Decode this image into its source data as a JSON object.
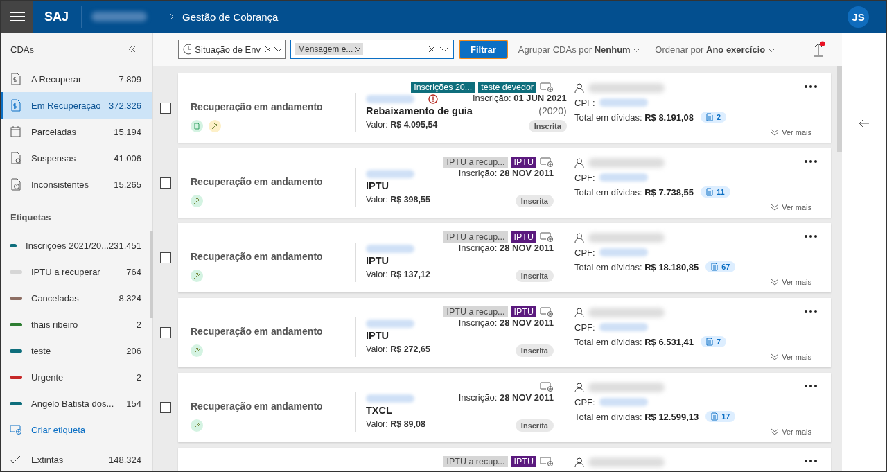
{
  "header": {
    "logo": "SAJ",
    "breadcrumb": "Gestão de Cobrança",
    "avatar": "JS"
  },
  "toolbar": {
    "filters": [
      {
        "kind": "clock",
        "value": "Situação de Env"
      },
      {
        "kind": "chips",
        "chips": [
          "Mensagem e..."
        ],
        "focused": true
      }
    ],
    "filter_button": "Filtrar",
    "group_label": "Agrupar CDAs por",
    "group_value": "Nenhum",
    "sort_label": "Ordenar por",
    "sort_value": "Ano exercício",
    "upload_notification": true
  },
  "sidebar": {
    "title": "CDAs",
    "categories": [
      {
        "label": "A Recuperar",
        "count": "7.809",
        "selected": false
      },
      {
        "label": "Em Recuperação",
        "count": "372.326",
        "selected": true
      },
      {
        "label": "Parceladas",
        "count": "15.194",
        "selected": false
      },
      {
        "label": "Suspensas",
        "count": "41.006",
        "selected": false
      },
      {
        "label": "Inconsistentes",
        "count": "15.265",
        "selected": false
      }
    ],
    "tags_title": "Etiquetas",
    "tags": [
      {
        "label": "Inscrições 2021/20...",
        "count": "231.451",
        "color": "#0e6e7c"
      },
      {
        "label": "IPTU a recuperar",
        "count": "764",
        "color": "#d6d6d6"
      },
      {
        "label": "Canceladas",
        "count": "8.324",
        "color": "#8d6e63"
      },
      {
        "label": "thais ribeiro",
        "count": "2",
        "color": "#2e7d32"
      },
      {
        "label": "teste",
        "count": "206",
        "color": "#0e6e7c"
      },
      {
        "label": "Urgente",
        "count": "2",
        "color": "#c62828"
      },
      {
        "label": "Angelo Batista dos...",
        "count": "154",
        "color": "#0e6e7c"
      }
    ],
    "create_tag": "Criar etiqueta",
    "extinct": {
      "label": "Extintas",
      "count": "148.324"
    }
  },
  "cards": [
    {
      "checked": false,
      "status": "Recuperação em andamento",
      "status_icons": [
        {
          "kind": "document",
          "color": "#d4f3e2"
        },
        {
          "kind": "gavel",
          "color": "#fdf0c8"
        }
      ],
      "tags": [
        {
          "label": "Inscrições 20...",
          "color": "#0e6e7c"
        },
        {
          "label": "teste devedor",
          "color": "#0e6e7c"
        }
      ],
      "warning": true,
      "inscricao_label": "Inscrição:",
      "inscricao": "01 JUN 2021",
      "subject": "Rebaixamento de guia",
      "year": "(2020)",
      "valor_label": "Valor:",
      "valor": "R$ 4.095,54",
      "badge": "Inscrita",
      "cpf_label": "CPF:",
      "total_label": "Total em dívidas:",
      "total": "R$ 8.191,08",
      "docs": "2",
      "more": "Ver mais"
    },
    {
      "checked": false,
      "status": "Recuperação em andamento",
      "status_icons": [
        {
          "kind": "gavel",
          "color": "#d4f3e2"
        }
      ],
      "tags": [
        {
          "label": "IPTU a recup...",
          "color": "#d6d6d6"
        },
        {
          "label": "IPTU",
          "color": "#5b1a7e"
        }
      ],
      "warning": false,
      "inscricao_label": "Inscrição:",
      "inscricao": "28 NOV 2011",
      "subject": "IPTU",
      "valor_label": "Valor:",
      "valor": "R$ 398,55",
      "badge": "Inscrita",
      "cpf_label": "CPF:",
      "total_label": "Total em dívidas:",
      "total": "R$ 7.738,55",
      "docs": "11",
      "more": "Ver mais"
    },
    {
      "checked": false,
      "status": "Recuperação em andamento",
      "status_icons": [
        {
          "kind": "gavel",
          "color": "#d4f3e2"
        }
      ],
      "tags": [
        {
          "label": "IPTU a recup...",
          "color": "#d6d6d6"
        },
        {
          "label": "IPTU",
          "color": "#5b1a7e"
        }
      ],
      "warning": false,
      "inscricao_label": "Inscrição:",
      "inscricao": "28 NOV 2011",
      "subject": "IPTU",
      "valor_label": "Valor:",
      "valor": "R$ 137,12",
      "badge": "Inscrita",
      "cpf_label": "CPF:",
      "total_label": "Total em dívidas:",
      "total": "R$ 18.180,85",
      "docs": "67",
      "more": "Ver mais"
    },
    {
      "checked": false,
      "status": "Recuperação em andamento",
      "status_icons": [
        {
          "kind": "gavel",
          "color": "#d4f3e2"
        }
      ],
      "tags": [
        {
          "label": "IPTU a recup...",
          "color": "#d6d6d6"
        },
        {
          "label": "IPTU",
          "color": "#5b1a7e"
        }
      ],
      "warning": false,
      "inscricao_label": "Inscrição:",
      "inscricao": "28 NOV 2011",
      "subject": "IPTU",
      "valor_label": "Valor:",
      "valor": "R$ 272,65",
      "badge": "Inscrita",
      "cpf_label": "CPF:",
      "total_label": "Total em dívidas:",
      "total": "R$ 6.531,41",
      "docs": "7",
      "more": "Ver mais"
    },
    {
      "checked": false,
      "status": "Recuperação em andamento",
      "status_icons": [
        {
          "kind": "gavel",
          "color": "#d4f3e2"
        }
      ],
      "warning": false,
      "inscricao_label": "Inscrição:",
      "inscricao": "28 NOV 2011",
      "subject": "TXCL",
      "valor_label": "Valor:",
      "valor": "R$ 89,08",
      "badge": "Inscrita",
      "cpf_label": "CPF:",
      "total_label": "Total em dívidas:",
      "total": "R$ 12.599,13",
      "docs": "17",
      "more": "Ver mais"
    },
    {
      "tags": [
        {
          "label": "IPTU a recup...",
          "color": "#d6d6d6"
        },
        {
          "label": "IPTU",
          "color": "#5b1a7e"
        }
      ]
    }
  ]
}
